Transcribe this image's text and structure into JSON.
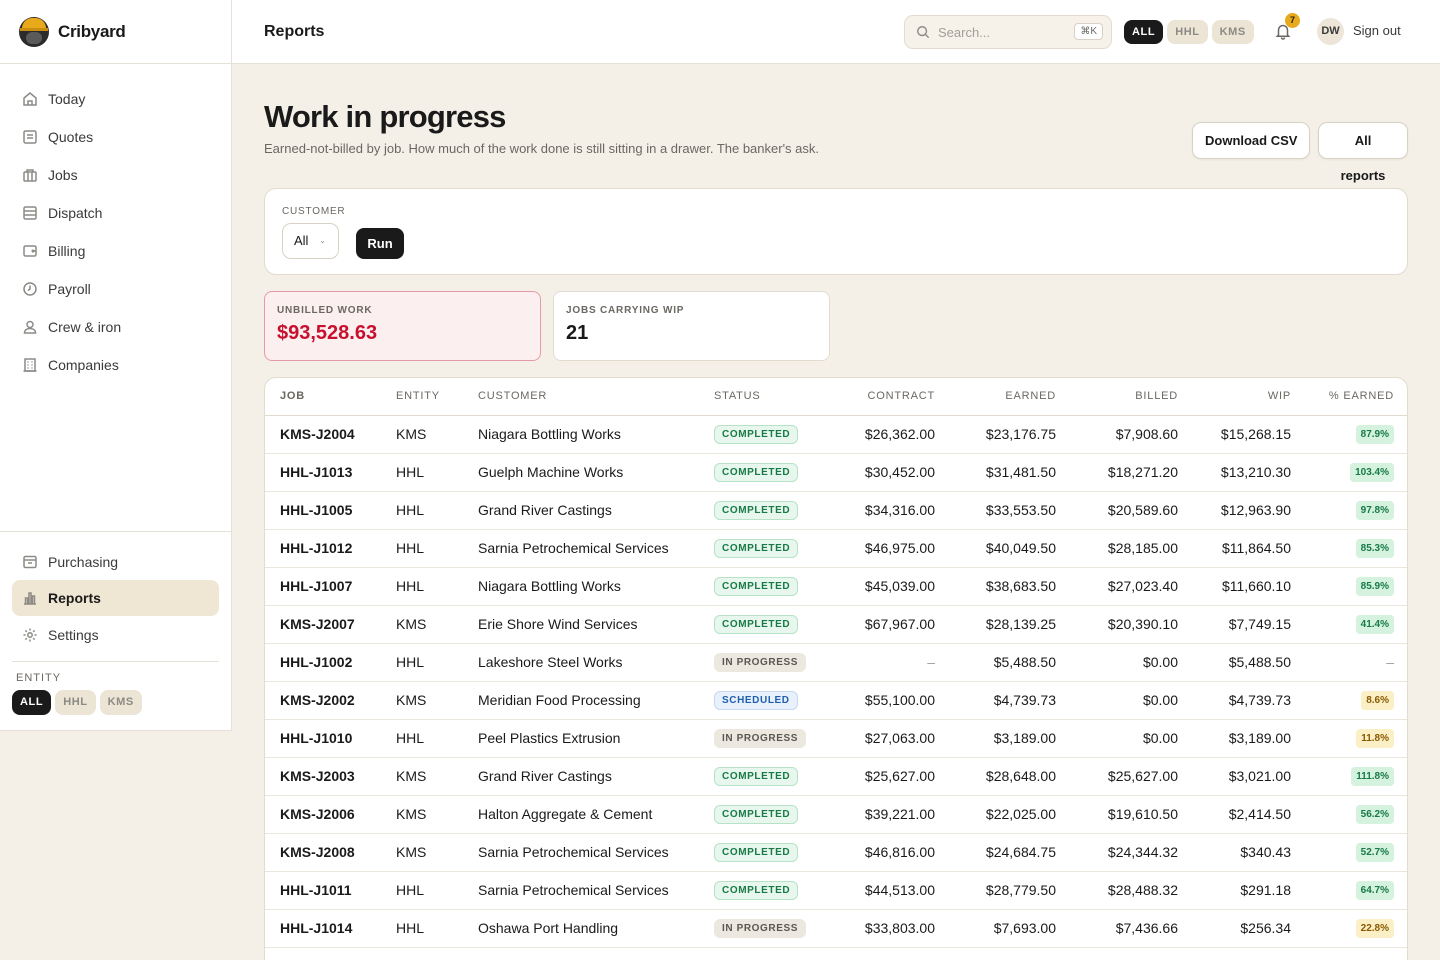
{
  "app": {
    "name": "Cribyard"
  },
  "sidebar": {
    "items": [
      {
        "label": "Today",
        "icon": "home-icon"
      },
      {
        "label": "Quotes",
        "icon": "document-icon"
      },
      {
        "label": "Jobs",
        "icon": "building-icon"
      },
      {
        "label": "Dispatch",
        "icon": "layout-icon"
      },
      {
        "label": "Billing",
        "icon": "wallet-icon"
      },
      {
        "label": "Payroll",
        "icon": "clock-icon"
      },
      {
        "label": "Crew & iron",
        "icon": "user-icon"
      },
      {
        "label": "Companies",
        "icon": "office-icon"
      }
    ],
    "bottom_items": [
      {
        "label": "Purchasing",
        "icon": "tray-icon"
      },
      {
        "label": "Reports",
        "icon": "bar-chart-icon",
        "active": true
      },
      {
        "label": "Settings",
        "icon": "gear-icon"
      }
    ],
    "entity_label": "ENTITY",
    "entity_chips": [
      "ALL",
      "HHL",
      "KMS"
    ]
  },
  "topbar": {
    "title": "Reports",
    "search_placeholder": "Search...",
    "search_shortcut": "⌘K",
    "entity_chips": [
      "ALL",
      "HHL",
      "KMS"
    ],
    "notification_count": "7",
    "avatar_initials": "DW",
    "sign_out": "Sign out"
  },
  "page": {
    "title": "Work in progress",
    "subtitle": "Earned-not-billed by job. How much of the work done is still sitting in a drawer. The banker's ask.",
    "download_csv": "Download CSV",
    "all_reports": "All reports"
  },
  "filter": {
    "customer_label": "CUSTOMER",
    "customer_value": "All",
    "run_label": "Run"
  },
  "stats": {
    "unbilled_label": "UNBILLED WORK",
    "unbilled_value": "$93,528.63",
    "jobs_label": "JOBS CARRYING WIP",
    "jobs_value": "21"
  },
  "table": {
    "columns": [
      "JOB",
      "ENTITY",
      "CUSTOMER",
      "STATUS",
      "CONTRACT",
      "EARNED",
      "BILLED",
      "WIP",
      "% EARNED"
    ],
    "rows": [
      {
        "job": "KMS-J2004",
        "entity": "KMS",
        "customer": "Niagara Bottling Works",
        "status": "COMPLETED",
        "contract": "$26,362.00",
        "earned": "$23,176.75",
        "billed": "$7,908.60",
        "wip": "$15,268.15",
        "pct": "87.9%"
      },
      {
        "job": "HHL-J1013",
        "entity": "HHL",
        "customer": "Guelph Machine Works",
        "status": "COMPLETED",
        "contract": "$30,452.00",
        "earned": "$31,481.50",
        "billed": "$18,271.20",
        "wip": "$13,210.30",
        "pct": "103.4%"
      },
      {
        "job": "HHL-J1005",
        "entity": "HHL",
        "customer": "Grand River Castings",
        "status": "COMPLETED",
        "contract": "$34,316.00",
        "earned": "$33,553.50",
        "billed": "$20,589.60",
        "wip": "$12,963.90",
        "pct": "97.8%"
      },
      {
        "job": "HHL-J1012",
        "entity": "HHL",
        "customer": "Sarnia Petrochemical Services",
        "status": "COMPLETED",
        "contract": "$46,975.00",
        "earned": "$40,049.50",
        "billed": "$28,185.00",
        "wip": "$11,864.50",
        "pct": "85.3%"
      },
      {
        "job": "HHL-J1007",
        "entity": "HHL",
        "customer": "Niagara Bottling Works",
        "status": "COMPLETED",
        "contract": "$45,039.00",
        "earned": "$38,683.50",
        "billed": "$27,023.40",
        "wip": "$11,660.10",
        "pct": "85.9%"
      },
      {
        "job": "KMS-J2007",
        "entity": "KMS",
        "customer": "Erie Shore Wind Services",
        "status": "COMPLETED",
        "contract": "$67,967.00",
        "earned": "$28,139.25",
        "billed": "$20,390.10",
        "wip": "$7,749.15",
        "pct": "41.4%"
      },
      {
        "job": "HHL-J1002",
        "entity": "HHL",
        "customer": "Lakeshore Steel Works",
        "status": "IN PROGRESS",
        "contract": "–",
        "earned": "$5,488.50",
        "billed": "$0.00",
        "wip": "$5,488.50",
        "pct": "–"
      },
      {
        "job": "KMS-J2002",
        "entity": "KMS",
        "customer": "Meridian Food Processing",
        "status": "SCHEDULED",
        "contract": "$55,100.00",
        "earned": "$4,739.73",
        "billed": "$0.00",
        "wip": "$4,739.73",
        "pct": "8.6%"
      },
      {
        "job": "HHL-J1010",
        "entity": "HHL",
        "customer": "Peel Plastics Extrusion",
        "status": "IN PROGRESS",
        "contract": "$27,063.00",
        "earned": "$3,189.00",
        "billed": "$0.00",
        "wip": "$3,189.00",
        "pct": "11.8%"
      },
      {
        "job": "KMS-J2003",
        "entity": "KMS",
        "customer": "Grand River Castings",
        "status": "COMPLETED",
        "contract": "$25,627.00",
        "earned": "$28,648.00",
        "billed": "$25,627.00",
        "wip": "$3,021.00",
        "pct": "111.8%"
      },
      {
        "job": "KMS-J2006",
        "entity": "KMS",
        "customer": "Halton Aggregate & Cement",
        "status": "COMPLETED",
        "contract": "$39,221.00",
        "earned": "$22,025.00",
        "billed": "$19,610.50",
        "wip": "$2,414.50",
        "pct": "56.2%"
      },
      {
        "job": "KMS-J2008",
        "entity": "KMS",
        "customer": "Sarnia Petrochemical Services",
        "status": "COMPLETED",
        "contract": "$46,816.00",
        "earned": "$24,684.75",
        "billed": "$24,344.32",
        "wip": "$340.43",
        "pct": "52.7%"
      },
      {
        "job": "HHL-J1011",
        "entity": "HHL",
        "customer": "Sarnia Petrochemical Services",
        "status": "COMPLETED",
        "contract": "$44,513.00",
        "earned": "$28,779.50",
        "billed": "$28,488.32",
        "wip": "$291.18",
        "pct": "64.7%"
      },
      {
        "job": "HHL-J1014",
        "entity": "HHL",
        "customer": "Oshawa Port Handling",
        "status": "IN PROGRESS",
        "contract": "$33,803.00",
        "earned": "$7,693.00",
        "billed": "$7,436.66",
        "wip": "$256.34",
        "pct": "22.8%"
      }
    ]
  },
  "colors": {
    "accent_red": "#c8102e",
    "completed_green": "#187a46",
    "scheduled_blue": "#1f5fae",
    "badge_amber": "#e8a91b"
  }
}
